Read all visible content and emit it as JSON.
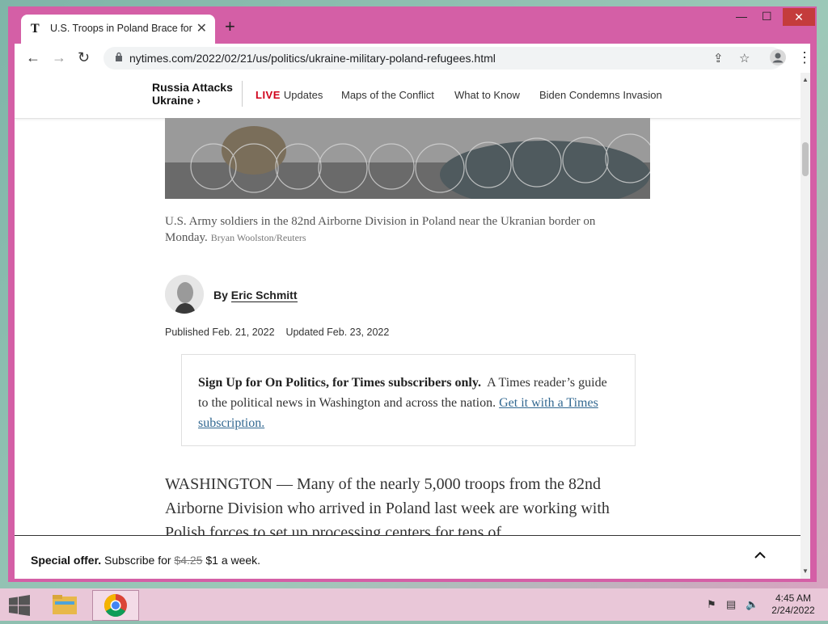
{
  "browser": {
    "tab_title": "U.S. Troops in Poland Brace for P",
    "tab_favicon": "T",
    "url": "nytimes.com/2022/02/21/us/politics/ukraine-military-poland-refugees.html",
    "window_controls": {
      "minimize": "—",
      "maximize": "☐",
      "close": "✕"
    }
  },
  "nyt_nav": {
    "brand_line1": "Russia Attacks",
    "brand_line2": "Ukraine ›",
    "live_label": "LIVE",
    "links": [
      "Updates",
      "Maps of the Conflict",
      "What to Know",
      "Biden Condemns Invasion"
    ]
  },
  "article": {
    "caption": "U.S. Army soldiers in the 82nd Airborne Division in Poland near the Ukranian border on Monday.",
    "credit": "Bryan Woolston/Reuters",
    "byline_prefix": "By",
    "author": "Eric Schmitt",
    "published": "Published Feb. 21, 2022",
    "updated": "Updated Feb. 23, 2022",
    "promo_bold": "Sign Up for On Politics, for Times subscribers only.",
    "promo_text": "A Times reader’s guide to the political news in Washington and across the nation.",
    "promo_link": "Get it with a Times subscription.",
    "body": "WASHINGTON — Many of the nearly 5,000 troops from the 82nd Airborne Division who arrived in Poland last week are working with Polish forces to set up processing centers for tens of"
  },
  "offer": {
    "label": "Special offer.",
    "text": "Subscribe for",
    "old_price": "$4.25",
    "new_price": "$1 a week."
  },
  "taskbar": {
    "time": "4:45 AM",
    "date": "2/24/2022"
  }
}
